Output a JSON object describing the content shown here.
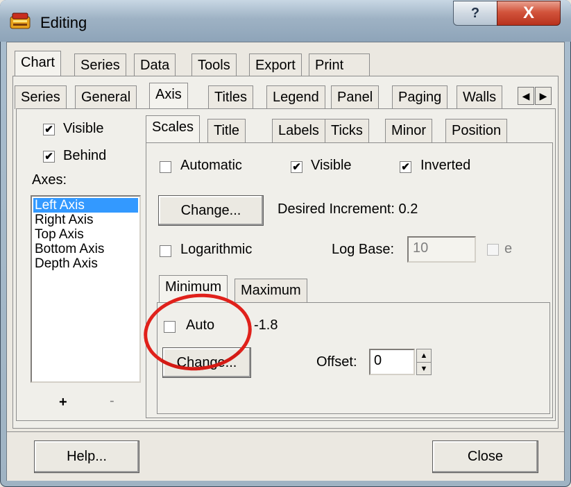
{
  "window": {
    "title": "Editing",
    "help_glyph": "?",
    "close_glyph": "X"
  },
  "main_tabs": [
    "Chart",
    "Series",
    "Data",
    "Tools",
    "Export",
    "Print"
  ],
  "chart_tabs": [
    "Series",
    "General",
    "Axis",
    "Titles",
    "Legend",
    "Panel",
    "Paging",
    "Walls"
  ],
  "axis_tabs": [
    "Scales",
    "Title",
    "Labels",
    "Ticks",
    "Minor",
    "Position"
  ],
  "left_panel": {
    "visible_label": "Visible",
    "visible_checked": true,
    "behind_label": "Behind",
    "behind_checked": true,
    "axes_label": "Axes:",
    "axes": [
      "Left Axis",
      "Right Axis",
      "Top Axis",
      "Bottom Axis",
      "Depth Axis"
    ],
    "selected_axis": "Left Axis",
    "add_label": "+",
    "remove_label": "-"
  },
  "scales": {
    "automatic_label": "Automatic",
    "automatic_checked": false,
    "visible_label": "Visible",
    "visible_checked": true,
    "inverted_label": "Inverted",
    "inverted_checked": true,
    "change_label": "Change...",
    "increment_text": "Desired Increment: 0.2",
    "logarithmic_label": "Logarithmic",
    "logarithmic_checked": false,
    "log_base_label": "Log Base:",
    "log_base_value": "10",
    "e_label": "e",
    "e_checked": false
  },
  "minmax_tabs": [
    "Minimum",
    "Maximum"
  ],
  "minimum": {
    "auto_label": "Auto",
    "auto_checked": false,
    "value": "-1.8",
    "change_label": "Change...",
    "offset_label": "Offset:",
    "offset_value": "0"
  },
  "footer": {
    "help_label": "Help...",
    "close_label": "Close"
  },
  "colors": {
    "selection": "#3399ff",
    "annotation_circle": "#e0211b"
  }
}
